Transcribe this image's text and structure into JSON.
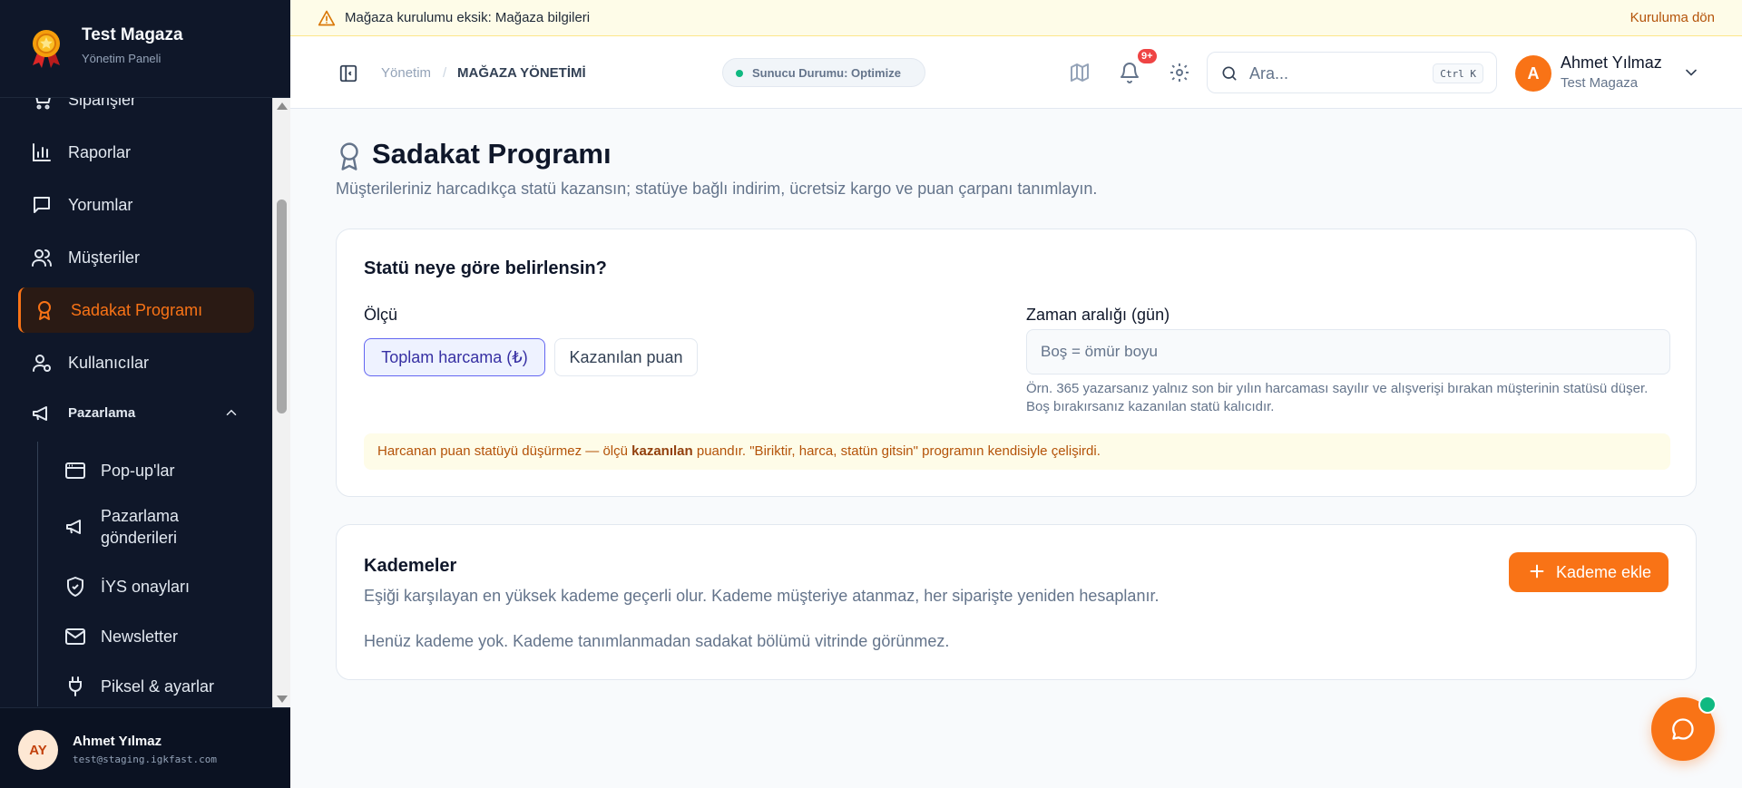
{
  "colors": {
    "accent": "#f97316",
    "sidebar_bg": "#0f1729",
    "active_bg": "#2a1a14",
    "status_green": "#10b981",
    "badge_red": "#ef4444",
    "warn_text": "#b45309"
  },
  "brand": {
    "title": "Test Magaza",
    "subtitle": "Yönetim Paneli",
    "logo_icon": "medal-icon"
  },
  "sidebar": {
    "items": [
      {
        "label": "Siparişler",
        "icon": "cart-icon"
      },
      {
        "label": "Raporlar",
        "icon": "bar-chart-icon"
      },
      {
        "label": "Yorumlar",
        "icon": "message-icon"
      },
      {
        "label": "Müşteriler",
        "icon": "users-icon"
      },
      {
        "label": "Sadakat Programı",
        "icon": "award-icon",
        "active": true
      },
      {
        "label": "Kullanıcılar",
        "icon": "user-cog-icon"
      }
    ],
    "group": {
      "label": "Pazarlama",
      "icon": "megaphone-icon",
      "expanded": true
    },
    "sub_items": [
      {
        "label": "Pop-up'lar",
        "icon": "browser-icon"
      },
      {
        "label": "Pazarlama gönderileri",
        "icon": "megaphone-icon"
      },
      {
        "label": "İYS onayları",
        "icon": "shield-check-icon"
      },
      {
        "label": "Newsletter",
        "icon": "mail-icon"
      },
      {
        "label": "Piksel & ayarlar",
        "icon": "plug-icon"
      }
    ]
  },
  "user_footer": {
    "initials": "AY",
    "name": "Ahmet Yılmaz",
    "email": "test@staging.igkfast.com"
  },
  "banner": {
    "prefix": "Mağaza kurulumu eksik:",
    "highlight": "Mağaza bilgileri",
    "link": "Kuruluma dön"
  },
  "header": {
    "breadcrumb_root": "Yönetim",
    "breadcrumb_sep": "/",
    "breadcrumb_current": "MAĞAZA YÖNETİMİ",
    "server_status": "Sunucu Durumu: Optimize",
    "notification_count": "9+",
    "search_placeholder": "Ara...",
    "search_shortcut": "Ctrl K",
    "user_initial": "A",
    "user_name": "Ahmet Yılmaz",
    "user_org": "Test Magaza"
  },
  "page": {
    "title": "Sadakat Programı",
    "description": "Müşterileriniz harcadıkça statü kazansın; statüye bağlı indirim, ücretsiz kargo ve puan çarpanı tanımlayın."
  },
  "status_card": {
    "heading": "Statü neye göre belirlensin?",
    "measure_label": "Ölçü",
    "options": [
      "Toplam harcama (₺)",
      "Kazanılan puan"
    ],
    "selected": "Toplam harcama (₺)",
    "period_label": "Zaman aralığı (gün)",
    "period_value": "",
    "period_placeholder": "Boş = ömür boyu",
    "period_help": "Örn. 365 yazarsanız yalnız son bir yılın harcaması sayılır ve alışverişi bırakan müşterinin statüsü düşer. Boş bırakırsanız kazanılan statü kalıcıdır.",
    "warning_pre": "Harcanan puan statüyü düşürmez — ölçü ",
    "warning_bold": "kazanılan",
    "warning_post": " puandır. \"Biriktir, harca, statün gitsin\" programın kendisiyle çelişirdi."
  },
  "tiers_card": {
    "heading": "Kademeler",
    "description": "Eşiği karşılayan en yüksek kademe geçerli olur. Kademe müşteriye atanmaz, her siparişte yeniden hesaplanır.",
    "empty": "Henüz kademe yok. Kademe tanımlanmadan sadakat bölümü vitrinde görünmez.",
    "add_button": "Kademe ekle"
  }
}
